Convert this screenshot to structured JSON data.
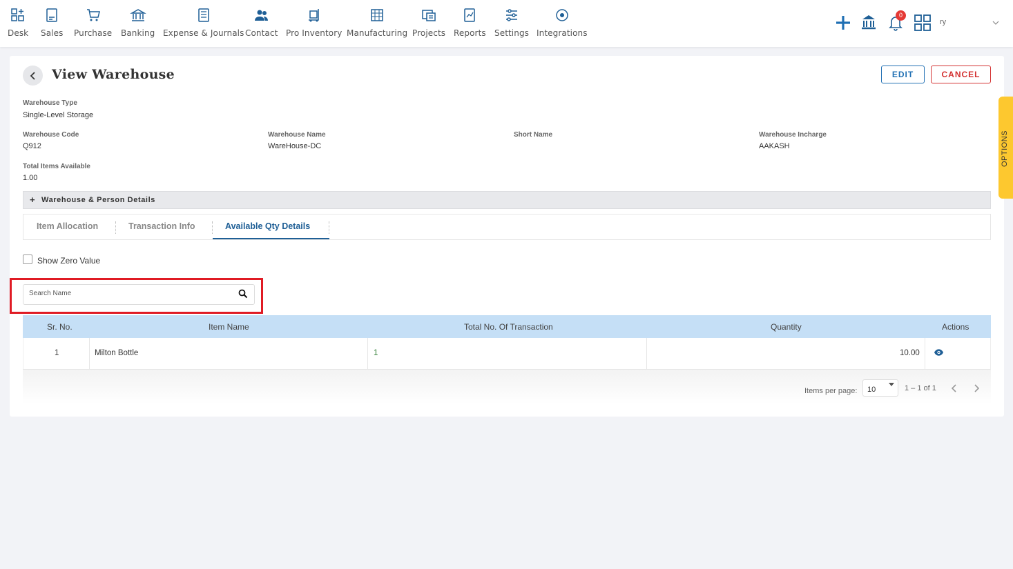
{
  "nav": {
    "items": [
      {
        "label": "Desk",
        "icon": "desk-icon"
      },
      {
        "label": "Sales",
        "icon": "sales-icon"
      },
      {
        "label": "Purchase",
        "icon": "cart-icon"
      },
      {
        "label": "Banking",
        "icon": "bank-icon"
      },
      {
        "label": "Expense & Journals",
        "icon": "journal-icon"
      },
      {
        "label": "Contact",
        "icon": "contact-icon"
      },
      {
        "label": "Pro Inventory",
        "icon": "inventory-icon"
      },
      {
        "label": "Manufacturing",
        "icon": "manufacturing-icon"
      },
      {
        "label": "Projects",
        "icon": "projects-icon"
      },
      {
        "label": "Reports",
        "icon": "reports-icon"
      },
      {
        "label": "Settings",
        "icon": "settings-icon"
      },
      {
        "label": "Integrations",
        "icon": "integrations-icon"
      }
    ],
    "notification_count": "0",
    "user_text": "ry"
  },
  "page": {
    "title": "View Warehouse",
    "edit_label": "EDIT",
    "cancel_label": "CANCEL",
    "options_label": "OPTIONS"
  },
  "fields": {
    "warehouse_type_label": "Warehouse Type",
    "warehouse_type_value": "Single-Level Storage",
    "warehouse_code_label": "Warehouse Code",
    "warehouse_code_value": "Q912",
    "warehouse_name_label": "Warehouse Name",
    "warehouse_name_value": "WareHouse-DC",
    "short_name_label": "Short Name",
    "warehouse_incharge_label": "Warehouse Incharge",
    "warehouse_incharge_value": "AAKASH",
    "total_items_label": "Total Items Available",
    "total_items_value": "1.00"
  },
  "section": {
    "plus": "+",
    "label": "Warehouse & Person Details"
  },
  "tabs": [
    {
      "label": "Item Allocation",
      "active": false
    },
    {
      "label": "Transaction Info",
      "active": false
    },
    {
      "label": "Available Qty Details",
      "active": true
    }
  ],
  "filters": {
    "show_zero_label": "Show Zero Value",
    "search_placeholder": "Search Name"
  },
  "table": {
    "headers": [
      "Sr. No.",
      "Item Name",
      "Total No. Of Transaction",
      "Quantity",
      "Actions"
    ],
    "rows": [
      {
        "sr": "1",
        "item": "Milton Bottle",
        "transactions": "1",
        "quantity": "10.00"
      }
    ]
  },
  "pager": {
    "items_per_page_label": "Items per page:",
    "page_size": "10",
    "range": "1 – 1 of 1"
  },
  "colors": {
    "accent": "#1f5f96",
    "cancel": "#d32f2f",
    "table_header": "#c5dff6",
    "options_tab": "#fdc82f",
    "highlight": "#e01b24"
  }
}
